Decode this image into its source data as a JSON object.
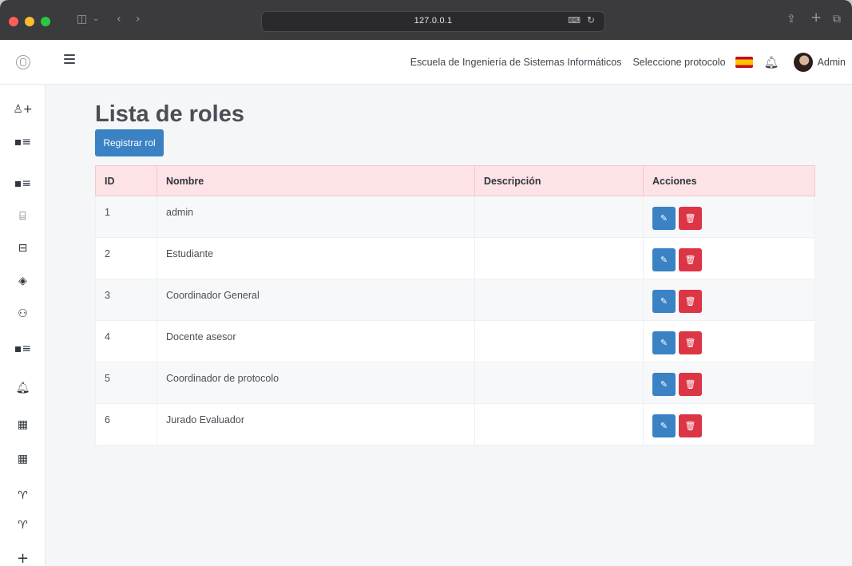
{
  "browser": {
    "url": "127.0.0.1",
    "icons": {
      "sidebar_toggle": "sidebar-icon",
      "back": "back-icon",
      "forward": "forward-icon",
      "translate": "translate-icon",
      "reload": "reload-icon",
      "share": "share-icon",
      "new_tab": "plus-icon",
      "tabs": "tabs-icon"
    }
  },
  "header": {
    "school": "Escuela de Ingeniería de Sistemas Informáticos",
    "protocol_selector": "Seleccione protocolo",
    "user_name": "Admin",
    "flag": "spain-flag"
  },
  "sidebar": {
    "items": [
      {
        "icon": "user-add-icon",
        "glyph": "♙+"
      },
      {
        "icon": "user-list-icon",
        "glyph": "▪≡"
      },
      {
        "icon": "user-list-icon-2",
        "glyph": "▪≡"
      },
      {
        "icon": "document-icon",
        "glyph": "⌸"
      },
      {
        "icon": "archive-icon",
        "glyph": "⊟"
      },
      {
        "icon": "support-icon",
        "glyph": "◈"
      },
      {
        "icon": "users-icon",
        "glyph": "⚇"
      },
      {
        "icon": "user-list-icon-3",
        "glyph": "▪≡"
      },
      {
        "icon": "bell-icon",
        "glyph": "🔔︎"
      },
      {
        "icon": "calendar-icon",
        "glyph": "▦"
      },
      {
        "icon": "calendar-icon-2",
        "glyph": "▦"
      },
      {
        "icon": "dislike-icon",
        "glyph": "♈"
      },
      {
        "icon": "dislike-icon-2",
        "glyph": "♈"
      },
      {
        "icon": "plus-icon",
        "glyph": "+"
      }
    ]
  },
  "page": {
    "title": "Lista de roles",
    "register_button": "Registrar rol"
  },
  "table": {
    "headers": [
      "ID",
      "Nombre",
      "Descripción",
      "Acciones"
    ],
    "rows": [
      {
        "id": "1",
        "name": "admin",
        "description": ""
      },
      {
        "id": "2",
        "name": "Estudiante",
        "description": ""
      },
      {
        "id": "3",
        "name": "Coordinador General",
        "description": ""
      },
      {
        "id": "4",
        "name": "Docente asesor",
        "description": ""
      },
      {
        "id": "5",
        "name": "Coordinador de protocolo",
        "description": ""
      },
      {
        "id": "6",
        "name": "Jurado Evaluador",
        "description": ""
      }
    ]
  },
  "colors": {
    "primary": "#3a82c4",
    "danger": "#dc3545",
    "table_header": "#fde3e6"
  }
}
